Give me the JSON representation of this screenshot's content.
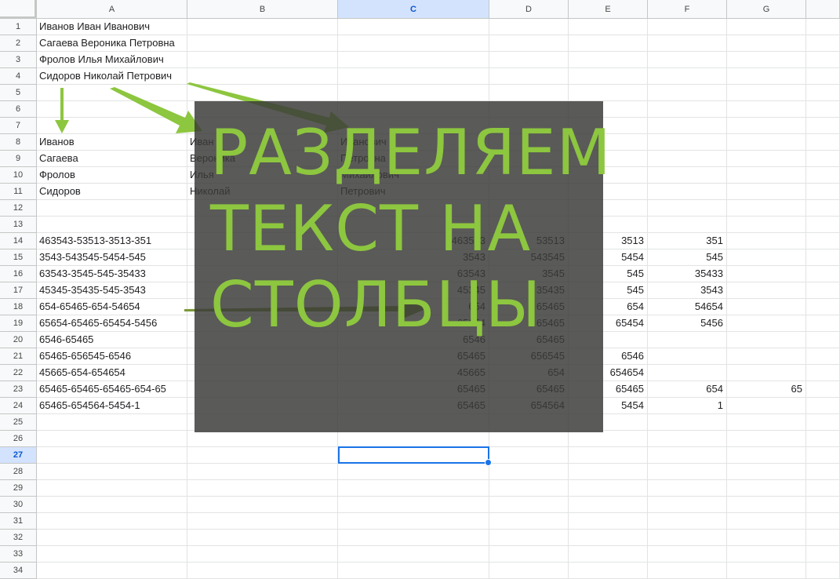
{
  "columns": [
    "A",
    "B",
    "C",
    "D",
    "E",
    "F",
    "G"
  ],
  "selected_column": "C",
  "selected_row": "27",
  "rows": [
    "1",
    "2",
    "3",
    "4",
    "5",
    "6",
    "7",
    "8",
    "9",
    "10",
    "11",
    "12",
    "13",
    "14",
    "15",
    "16",
    "17",
    "18",
    "19",
    "20",
    "21",
    "22",
    "23",
    "24",
    "25",
    "26",
    "27",
    "28",
    "29",
    "30",
    "31",
    "32",
    "33",
    "34"
  ],
  "cells": {
    "A1": "Иванов Иван Иванович",
    "A2": "Сагаева Вероника Петровна",
    "A3": "Фролов Илья Михайлович",
    "A4": "Сидоров Николай Петрович",
    "A8": "Иванов",
    "B8": "Иван",
    "C8": "Иванович",
    "A9": "Сагаева",
    "B9": "Вероника",
    "C9": "Петровна",
    "A10": "Фролов",
    "B10": "Илья",
    "C10": "Михайлович",
    "A11": "Сидоров",
    "B11": "Николай",
    "C11": "Петрович",
    "A14": "463543-53513-3513-351",
    "C14": "463543",
    "D14": "53513",
    "E14": "3513",
    "F14": "351",
    "A15": "3543-543545-5454-545",
    "C15": "3543",
    "D15": "543545",
    "E15": "5454",
    "F15": "545",
    "A16": "63543-3545-545-35433",
    "C16": "63543",
    "D16": "3545",
    "E16": "545",
    "F16": "35433",
    "A17": "45345-35435-545-3543",
    "C17": "45345",
    "D17": "35435",
    "E17": "545",
    "F17": "3543",
    "A18": "654-65465-654-54654",
    "C18": "654",
    "D18": "65465",
    "E18": "654",
    "F18": "54654",
    "A19": "65654-65465-65454-5456",
    "C19": "65654",
    "D19": "65465",
    "E19": "65454",
    "F19": "5456",
    "A20": "6546-65465",
    "C20": "6546",
    "D20": "65465",
    "A21": "65465-656545-6546",
    "C21": "65465",
    "D21": "656545",
    "E21": "6546",
    "A22": "45665-654-654654",
    "C22": "45665",
    "D22": "654",
    "E22": "654654",
    "A23": "65465-65465-65465-654-65",
    "C23": "65465",
    "D23": "65465",
    "E23": "65465",
    "F23": "654",
    "G23": "65",
    "A24": "65465-654564-5454-1",
    "C24": "65465",
    "D24": "654564",
    "E24": "5454",
    "F24": "1"
  },
  "overlay": {
    "title": "РАЗДЕЛЯЕМ ТЕКСТ НА СТОЛБЦЫ",
    "bg_color": "#3a3a38",
    "text_color": "#8dc63f"
  },
  "arrow_color": "#8dc63f",
  "selection_color": "#1a73e8"
}
